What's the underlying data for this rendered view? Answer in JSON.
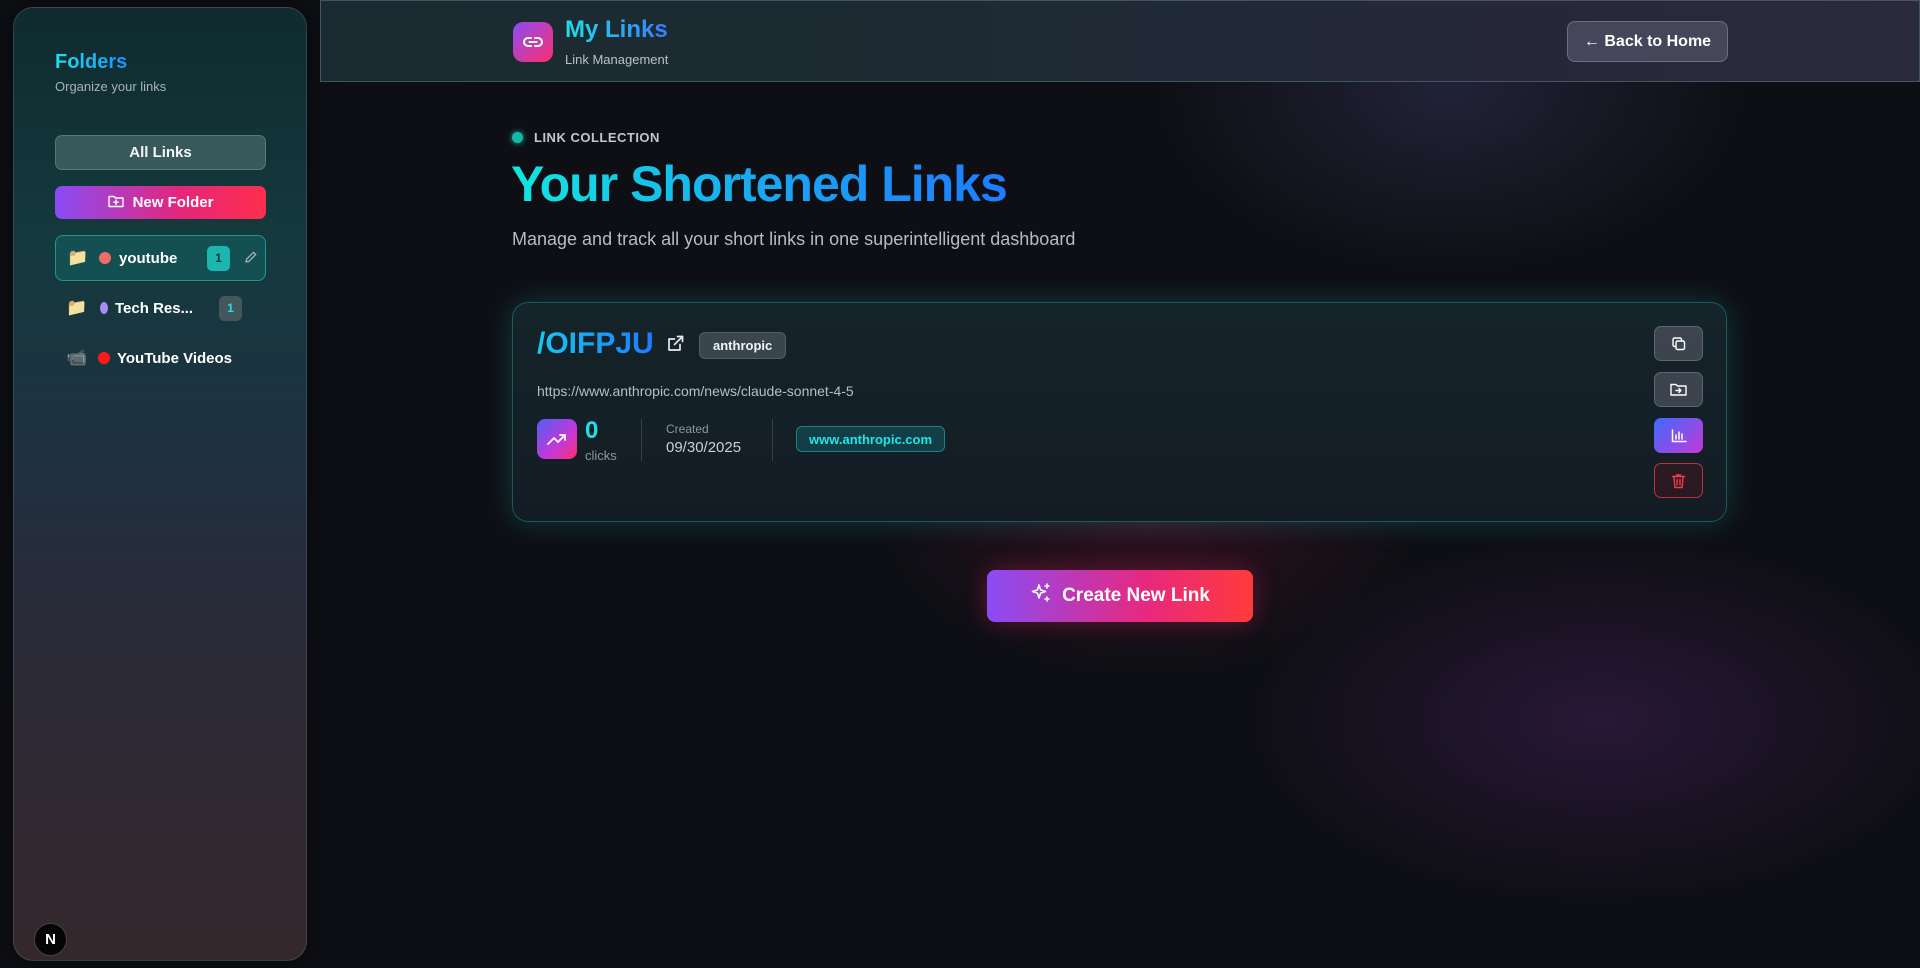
{
  "sidebar": {
    "title": "Folders",
    "subtitle": "Organize your links",
    "all_links_label": "All Links",
    "new_folder_label": "New Folder",
    "folders": [
      {
        "icon": "📁",
        "name": "youtube",
        "color": "#f26b6b",
        "count": "1",
        "active": true
      },
      {
        "icon": "📁",
        "name": "Tech Res...",
        "color": "#a78bfa",
        "count": "1",
        "active": false
      },
      {
        "icon": "📹",
        "name": "YouTube Videos",
        "color": "#ff1a1a",
        "count": null,
        "active": false
      }
    ],
    "badge_letter": "N"
  },
  "header": {
    "title": "My Links",
    "subtitle": "Link Management",
    "back_label": "← Back to Home"
  },
  "main": {
    "eyebrow": "LINK COLLECTION",
    "title": "Your Shortened Links",
    "description": "Manage and track all your short links in one superintelligent dashboard",
    "links": [
      {
        "slug": "/OIFPJU",
        "tag": "anthropic",
        "destination": "https://www.anthropic.com/news/claude-sonnet-4-5",
        "clicks": "0",
        "clicks_label": "clicks",
        "created_label": "Created",
        "created": "09/30/2025",
        "domain": "www.anthropic.com"
      }
    ],
    "create_label": "Create New Link"
  },
  "colors": {
    "accent_cyan": "#1ee0e8",
    "accent_blue": "#1e7bff",
    "accent_pink": "#e8287e",
    "accent_purple": "#8a4cf5",
    "danger": "#f03c46"
  }
}
